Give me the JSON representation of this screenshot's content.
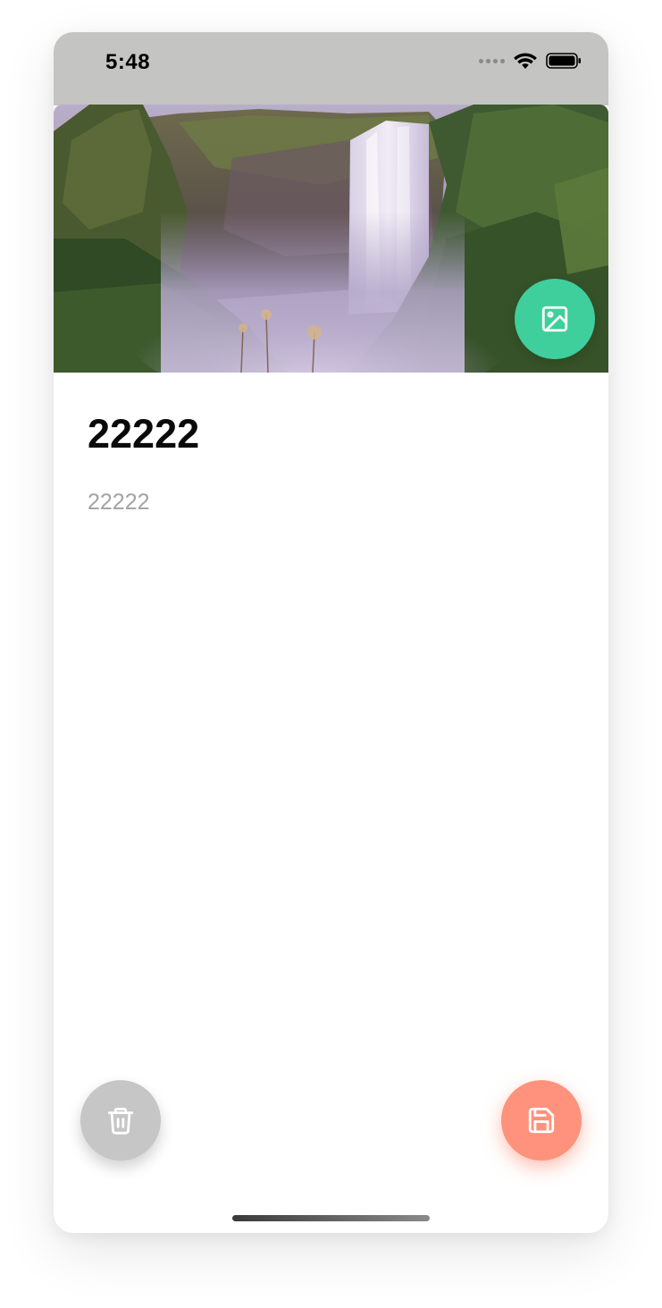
{
  "status_bar": {
    "time": "5:48",
    "icons": [
      "signal-dots-icon",
      "wifi-icon",
      "battery-icon"
    ]
  },
  "hero_image": {
    "description_icon": "waterfall-photo",
    "change_image_icon": "image-icon",
    "fab_color": "#3ecf9d"
  },
  "note": {
    "title": "22222",
    "body": "22222"
  },
  "actions": {
    "delete_icon": "trash-icon",
    "delete_color": "#c6c6c6",
    "save_icon": "save-icon",
    "save_color": "#fe927c"
  }
}
